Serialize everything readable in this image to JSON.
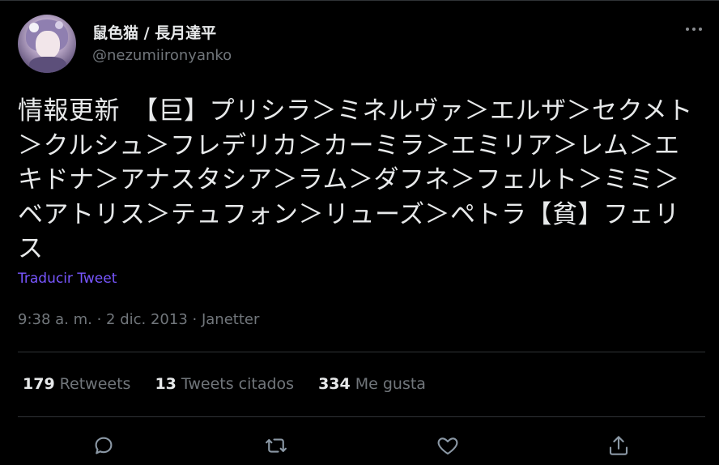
{
  "author": {
    "display_name": "鼠色猫 / 長月達平",
    "handle": "@nezumiironyanko"
  },
  "tweet": {
    "text": "情報更新　【巨】プリシラ＞ミネルヴァ＞エルザ＞セクメト＞クルシュ＞フレデリカ＞カーミラ＞エミリア＞レム＞エキドナ＞アナスタシア＞ラム＞ダフネ＞フェルト＞ミミ＞ベアトリス＞テュフォン＞リューズ＞ペトラ【貧】フェリス",
    "translate_label": "Traducir Tweet",
    "meta": "9:38 a. m. · 2 dic. 2013 · Janetter"
  },
  "stats": {
    "retweets": {
      "count": "179",
      "label": "Retweets"
    },
    "quotes": {
      "count": "13",
      "label": "Tweets citados"
    },
    "likes": {
      "count": "334",
      "label": "Me gusta"
    }
  },
  "icons": {
    "more": "more-dots-icon",
    "reply": "reply-icon",
    "retweet": "retweet-icon",
    "like": "heart-icon",
    "share": "share-icon"
  },
  "colors": {
    "background": "#000000",
    "text": "#e7e9ea",
    "secondary": "#71767b",
    "accent": "#7856ff",
    "divider": "#2f3336"
  }
}
